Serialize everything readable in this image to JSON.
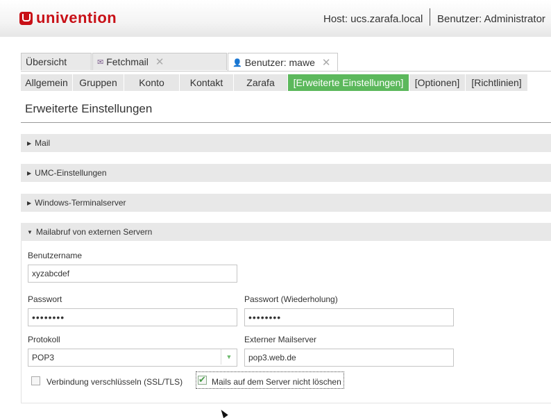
{
  "header": {
    "brand": "univention",
    "host": "Host: ucs.zarafa.local",
    "user": "Benutzer: Administrator",
    "brand_color": "#c81017"
  },
  "tabs": [
    {
      "label": "Übersicht",
      "icon": null,
      "closable": false
    },
    {
      "label": "Fetchmail",
      "icon": "mail-icon",
      "closable": true
    },
    {
      "label": "Benutzer: mawe",
      "icon": "user-icon",
      "closable": true
    }
  ],
  "subtabs": [
    {
      "label": "Allgemein"
    },
    {
      "label": "Gruppen"
    },
    {
      "label": "Konto"
    },
    {
      "label": "Kontakt"
    },
    {
      "label": "Zarafa"
    },
    {
      "label": "[Erweiterte Einstellungen]"
    },
    {
      "label": "[Optionen]"
    },
    {
      "label": "[Richtlinien]"
    }
  ],
  "accent_color": "#5cb85c",
  "page_title": "Erweiterte Einstellungen",
  "sections": [
    {
      "label": "Mail",
      "expanded": false
    },
    {
      "label": "UMC-Einstellungen",
      "expanded": false
    },
    {
      "label": "Windows-Terminalserver",
      "expanded": false
    },
    {
      "label": "Mailabruf von externen Servern",
      "expanded": true
    }
  ],
  "form": {
    "username_label": "Benutzername",
    "username_value": "xyzabcdef",
    "password_label": "Passwort",
    "password_value": "••••••••",
    "password_repeat_label": "Passwort (Wiederholung)",
    "password_repeat_value": "••••••••",
    "protocol_label": "Protokoll",
    "protocol_value": "POP3",
    "server_label": "Externer Mailserver",
    "server_value": "pop3.web.de",
    "ssl_label": "Verbindung verschlüsseln (SSL/TLS)",
    "ssl_checked": false,
    "keep_label": "Mails auf dem Server nicht löschen",
    "keep_checked": true
  }
}
